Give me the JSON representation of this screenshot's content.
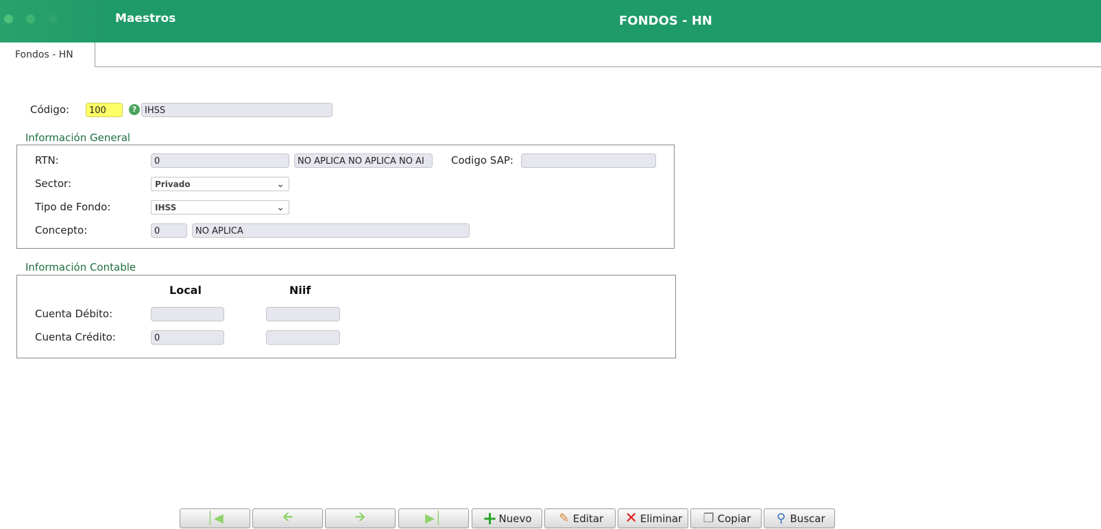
{
  "header": {
    "app_name": "Maestros",
    "title": "FONDOS - HN"
  },
  "tabs": [
    {
      "label": "Fondos - HN",
      "active": true
    }
  ],
  "codigo": {
    "label": "Código:",
    "value": "100",
    "description": "IHSS",
    "help_icon": "help-question-icon"
  },
  "info_general": {
    "legend": "Información General",
    "rtn": {
      "label": "RTN:",
      "value": "0",
      "name_value": "NO APLICA NO APLICA NO AI"
    },
    "codigo_sap": {
      "label": "Codigo SAP:",
      "value": ""
    },
    "sector": {
      "label": "Sector:",
      "selected": "Privado"
    },
    "tipo_fondo": {
      "label": "Tipo de Fondo:",
      "selected": "IHSS"
    },
    "concepto": {
      "label": "Concepto:",
      "value": "0",
      "description": "NO APLICA"
    }
  },
  "info_contable": {
    "legend": "Información Contable",
    "col_local": "Local",
    "col_niif": "Niif",
    "debito": {
      "label": "Cuenta Débito:",
      "local": "",
      "niif": ""
    },
    "credito": {
      "label": "Cuenta Crédito:",
      "local": "0",
      "niif": ""
    }
  },
  "toolbar": {
    "first_icon": "first-record-icon",
    "prev_icon": "previous-record-icon",
    "next_icon": "next-record-icon",
    "last_icon": "last-record-icon",
    "nuevo": "Nuevo",
    "editar": "Editar",
    "eliminar": "Eliminar",
    "copiar": "Copiar",
    "buscar": "Buscar"
  },
  "colors": {
    "header_bg": "#1f9a69",
    "legend_text": "#1d6e3e",
    "highlight_field": "#ffff66"
  }
}
